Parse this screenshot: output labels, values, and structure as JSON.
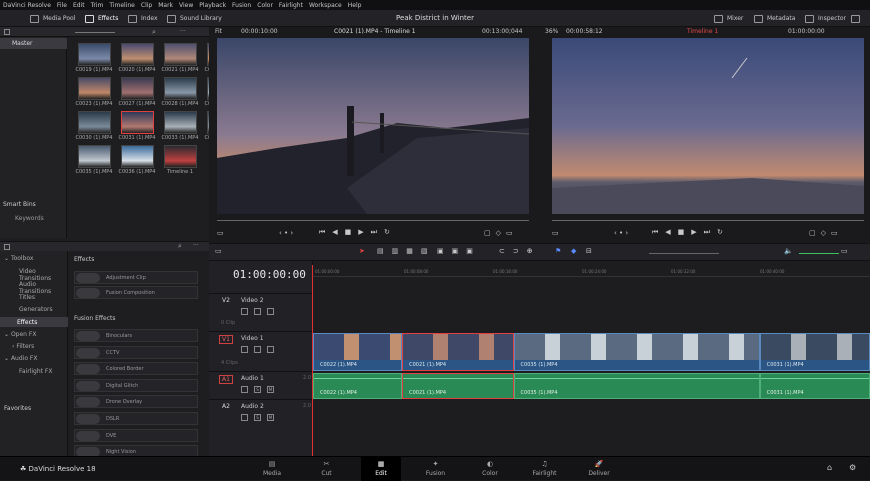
{
  "menubar": [
    "DaVinci Resolve",
    "File",
    "Edit",
    "Trim",
    "Timeline",
    "Clip",
    "Mark",
    "View",
    "Playback",
    "Fusion",
    "Color",
    "Fairlight",
    "Workspace",
    "Help"
  ],
  "toolbar": {
    "media_pool": "Media Pool",
    "effects": "Effects",
    "index": "Index",
    "sound_library": "Sound Library",
    "project_title": "Peak District in Winter",
    "mixer": "Mixer",
    "metadata": "Metadata",
    "inspector": "Inspector"
  },
  "bins": {
    "master": "Master",
    "smart_bins": "Smart Bins",
    "keywords": "Keywords"
  },
  "clips": [
    {
      "label": "C0019 (1).MP4",
      "colors": [
        "#3a4a6a",
        "#7a8aa8"
      ]
    },
    {
      "label": "C0020 (1).MP4",
      "colors": [
        "#4a4a70",
        "#c09070"
      ]
    },
    {
      "label": "C0021 (1).MP4",
      "colors": [
        "#505070",
        "#b08878"
      ]
    },
    {
      "label": "C0022 (1).MP4",
      "colors": [
        "#3a4a70",
        "#d09060"
      ]
    },
    {
      "label": "C0023 (1).MP4",
      "colors": [
        "#4a4a68",
        "#c08868"
      ]
    },
    {
      "label": "C0027 (1).MP4",
      "colors": [
        "#3a3a50",
        "#a07070"
      ]
    },
    {
      "label": "C0028 (1).MP4",
      "colors": [
        "#2a3a48",
        "#8898a8"
      ]
    },
    {
      "label": "C0029 (1).MP4",
      "colors": [
        "#384858",
        "#a0b0b8"
      ]
    },
    {
      "label": "C0030 (1).MP4",
      "colors": [
        "#2a3a48",
        "#7a8a98"
      ]
    },
    {
      "label": "C0031 (1).MP4",
      "colors": [
        "#303858",
        "#b07870"
      ],
      "selected": true
    },
    {
      "label": "C0033 (1).MP4",
      "colors": [
        "#2a3a4a",
        "#a8b0b8"
      ]
    },
    {
      "label": "C0034 (1).MP4",
      "colors": [
        "#3a4050",
        "#8a9098"
      ]
    },
    {
      "label": "C0035 (1).MP4",
      "colors": [
        "#4a5a70",
        "#c0c8d0"
      ]
    },
    {
      "label": "C0036 (1).MP4",
      "colors": [
        "#3a6a9a",
        "#d8e0e8"
      ]
    },
    {
      "label": "Timeline 1",
      "colors": [
        "#2a2a30",
        "#c04040"
      ]
    }
  ],
  "fx_tree": {
    "toolbox": "Toolbox",
    "items": [
      "Video Transitions",
      "Audio Transitions",
      "Titles",
      "Generators",
      "Effects"
    ],
    "open_fx": "Open FX",
    "filters": "Filters",
    "audio_fx": "Audio FX",
    "fairlight_fx": "Fairlight FX",
    "favorites": "Favorites"
  },
  "fx_list": {
    "effects_header": "Effects",
    "effects_items": [
      "Adjustment Clip",
      "Fusion Composition"
    ],
    "fusion_header": "Fusion Effects",
    "fusion_items": [
      "Binoculars",
      "CCTV",
      "Colored Border",
      "Digital Glitch",
      "Drone Overlay",
      "DSLR",
      "DVE",
      "Night Vision"
    ]
  },
  "source_viewer": {
    "fit": "Fit",
    "tc_left": "00:00:10:00",
    "clip": "C0021 (1).MP4 - Timeline 1",
    "tc_right": "00:13:00;044"
  },
  "timeline_viewer": {
    "zoom": "36%",
    "tc_left": "00:00:58:12",
    "timeline": "Timeline 1",
    "tc_right": "01:00:00:00"
  },
  "timeline": {
    "timecode": "01:00:00:00",
    "ruler": [
      "01:00:00:00",
      "01:00:08:00",
      "01:00:16:00",
      "01:00:24:00",
      "01:00:32:00",
      "01:00:40:00"
    ],
    "tracks": [
      {
        "id": "V2",
        "name": "Video 2",
        "meta": "0 Clip"
      },
      {
        "id": "V1",
        "name": "Video 1",
        "meta": "4 Clips"
      },
      {
        "id": "A1",
        "name": "Audio 1",
        "meta": "2.0"
      },
      {
        "id": "A2",
        "name": "Audio 2",
        "meta": "2.0"
      }
    ],
    "video_clips": [
      {
        "label": "C0022 (1).MP4",
        "start": 0.0,
        "end": 0.16
      },
      {
        "label": "C0021 (1).MP4",
        "start": 0.16,
        "end": 0.36,
        "selected": true
      },
      {
        "label": "C0035 (1).MP4",
        "start": 0.36,
        "end": 0.802
      },
      {
        "label": "C0031 (1).MP4",
        "start": 0.802,
        "end": 1.0
      }
    ],
    "audio_clips": [
      {
        "label": "C0022 (1).MP4",
        "start": 0.0,
        "end": 0.16
      },
      {
        "label": "C0021 (1).MP4",
        "start": 0.16,
        "end": 0.36,
        "selected": true
      },
      {
        "label": "C0035 (1).MP4",
        "start": 0.36,
        "end": 0.802
      },
      {
        "label": "C0031 (1).MP4",
        "start": 0.802,
        "end": 1.0
      }
    ]
  },
  "product": "DaVinci Resolve 18",
  "pages": [
    "Media",
    "Cut",
    "Edit",
    "Fusion",
    "Color",
    "Fairlight",
    "Deliver"
  ],
  "active_page": "Edit"
}
